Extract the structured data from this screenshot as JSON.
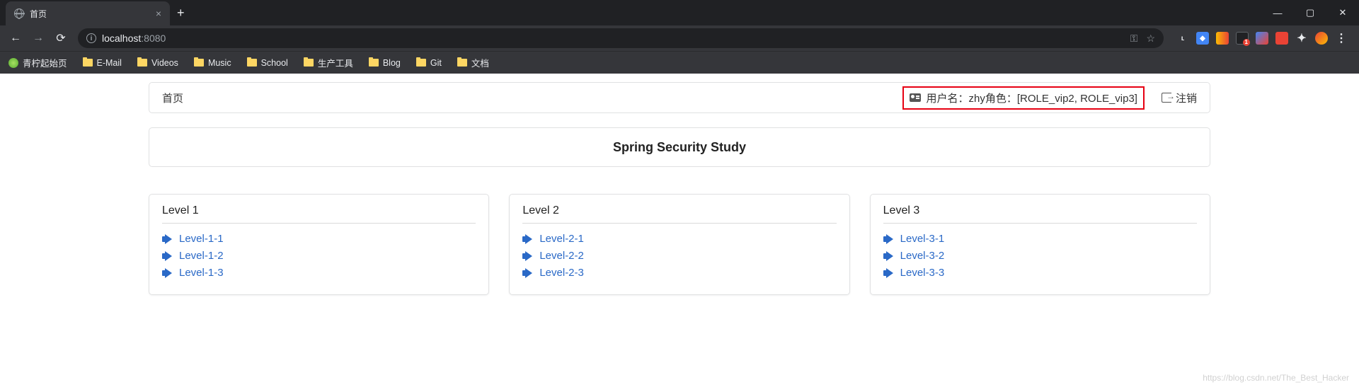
{
  "browser": {
    "tab_title": "首页",
    "new_tab": "+",
    "url_host": "localhost",
    "url_port": ":8080",
    "bookmarks": [
      "青柠起始页",
      "E-Mail",
      "Videos",
      "Music",
      "School",
      "生产工具",
      "Blog",
      "Git",
      "文档"
    ]
  },
  "header": {
    "home": "首页",
    "user_label": "用户名：",
    "user_name": "zhy",
    "role_label": "角色：",
    "roles": "[ROLE_vip2, ROLE_vip3]",
    "logout": "注销"
  },
  "title": "Spring Security Study",
  "cards": [
    {
      "title": "Level 1",
      "links": [
        "Level-1-1",
        "Level-1-2",
        "Level-1-3"
      ]
    },
    {
      "title": "Level 2",
      "links": [
        "Level-2-1",
        "Level-2-2",
        "Level-2-3"
      ]
    },
    {
      "title": "Level 3",
      "links": [
        "Level-3-1",
        "Level-3-2",
        "Level-3-3"
      ]
    }
  ],
  "watermark": "https://blog.csdn.net/The_Best_Hacker"
}
